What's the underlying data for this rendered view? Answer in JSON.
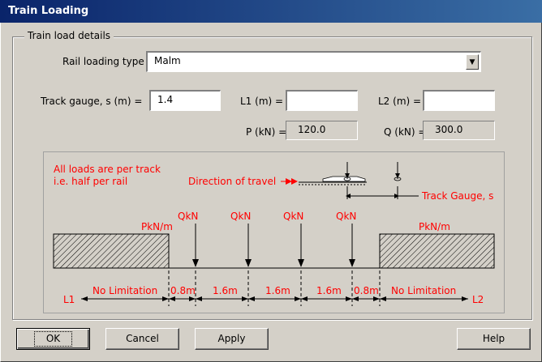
{
  "window": {
    "title": "Train Loading"
  },
  "group": {
    "legend": "Train load details"
  },
  "fields": {
    "rail_type_label": "Rail loading type",
    "rail_type_value": "Malm",
    "gauge_label": "Track gauge, s (m) =",
    "gauge_value": "1.4",
    "l1_label": "L1 (m) =",
    "l1_value": "",
    "l2_label": "L2 (m) =",
    "l2_value": "",
    "p_label": "P (kN) =",
    "p_value": "120.0",
    "q_label": "Q (kN) =",
    "q_value": "300.0"
  },
  "diagram": {
    "note_line1": "All loads are per track",
    "note_line2": "i.e. half per rail",
    "direction": "Direction of travel",
    "track_gauge": "Track Gauge, s",
    "udl_left": "PkN/m",
    "udl_right": "PkN/m",
    "point_loads": [
      "QkN",
      "QkN",
      "QkN",
      "QkN"
    ],
    "dims": [
      "No Limitation",
      "0.8m",
      "1.6m",
      "1.6m",
      "1.6m",
      "0.8m",
      "No Limitation"
    ],
    "l1": "L1",
    "l2": "L2",
    "red": "#ff0000"
  },
  "buttons": {
    "ok": "OK",
    "cancel": "Cancel",
    "apply": "Apply",
    "help": "Help"
  }
}
